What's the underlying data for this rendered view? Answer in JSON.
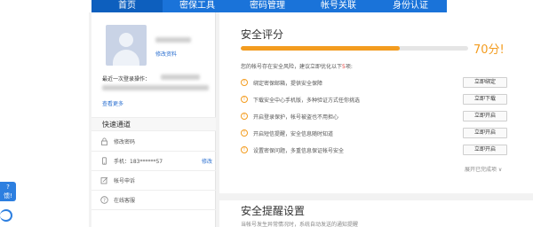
{
  "nav": {
    "items": [
      {
        "label": "首页",
        "active": true
      },
      {
        "label": "密保工具",
        "active": false
      },
      {
        "label": "密码管理",
        "active": false
      },
      {
        "label": "帐号关联",
        "active": false
      },
      {
        "label": "身份认证",
        "active": false
      }
    ]
  },
  "float": {
    "badge_text": "?\n馈！"
  },
  "sidebar": {
    "edit_profile": "修改资料",
    "last_login_label": "最近一次登录操作：",
    "view_more": "查看更多",
    "quick_title": "快速通道",
    "quick_items": [
      {
        "icon": "lock-icon",
        "label": "修改密码",
        "right": ""
      },
      {
        "icon": "phone-icon",
        "label": "手机：183******57",
        "right": "修改"
      },
      {
        "icon": "edit-icon",
        "label": "帐号申诉",
        "right": ""
      },
      {
        "icon": "help-icon",
        "label": "在线客服",
        "right": ""
      }
    ]
  },
  "security": {
    "title": "安全评分",
    "score_value": 70,
    "score_text": "70分!",
    "intro_prefix": "您的帐号存在安全风险，建议立即优化以下",
    "intro_count": "5",
    "intro_suffix": "项:",
    "items": [
      {
        "text": "绑定密保邮箱，提供安全保障",
        "button": "立即绑定"
      },
      {
        "text": "下载安全中心手机版，多种验证方式任你挑选",
        "button": "立即下载"
      },
      {
        "text": "开启登录保护，帐号被盗也不用担心",
        "button": "立即开启"
      },
      {
        "text": "开启短信提醒，安全信息随时知道",
        "button": "立即开启"
      },
      {
        "text": "设置密保问题，多重信息保证帐号安全",
        "button": "立即开启"
      }
    ],
    "expand_text": "展开已完成项 ∨"
  },
  "reminder": {
    "title": "安全提醒设置",
    "desc": "当帐号发生异常情况时，系统自动发送的通知提醒"
  },
  "colors": {
    "nav": "#1a73d9",
    "score": "#f39c1f",
    "link": "#2a6fd0"
  }
}
